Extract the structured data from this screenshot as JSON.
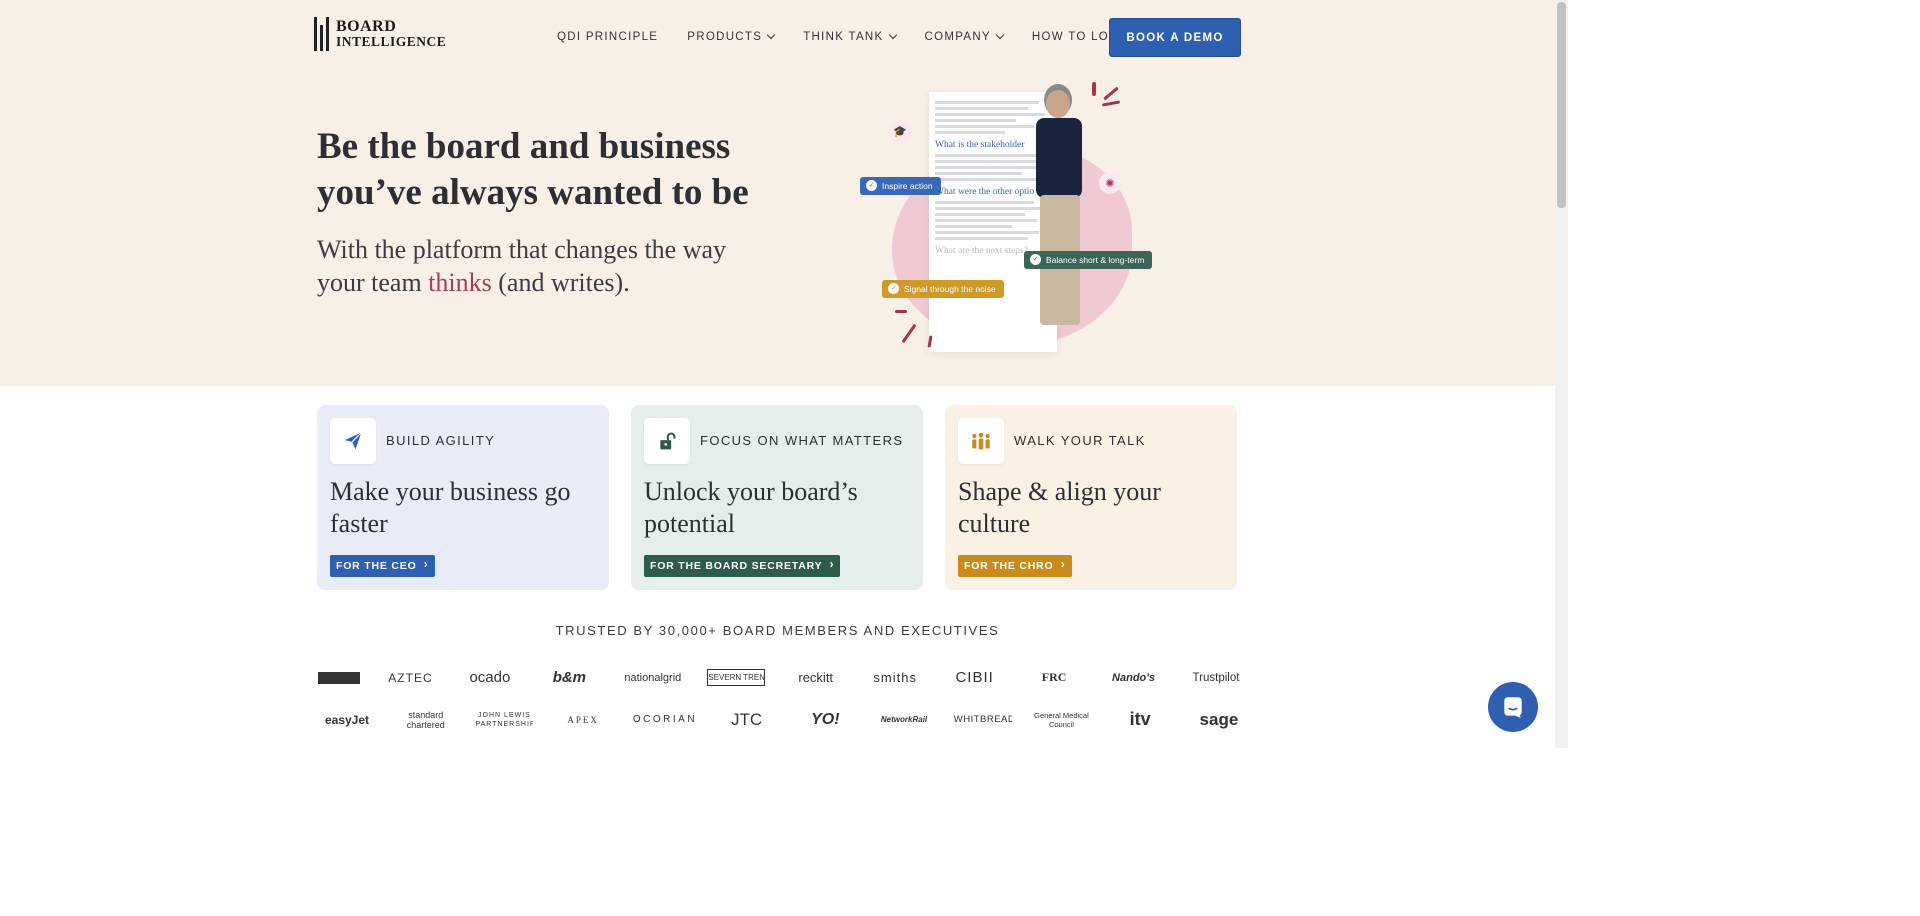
{
  "brand": {
    "line1": "BOARD",
    "line2": "INTELLIGENCE"
  },
  "nav": {
    "items": [
      {
        "label": "QDI PRINCIPLE",
        "dropdown": false
      },
      {
        "label": "PRODUCTS",
        "dropdown": true
      },
      {
        "label": "THINK TANK",
        "dropdown": true
      },
      {
        "label": "COMPANY",
        "dropdown": true
      },
      {
        "label": "HOW TO LOG IN",
        "dropdown": false
      }
    ],
    "cta": "BOOK A DEMO"
  },
  "hero": {
    "title": "Be the board and business you’ve always wanted to be",
    "sub_before": "With the platform that changes the way your team ",
    "sub_highlight": "thinks",
    "sub_after": " (and writes).",
    "illustration": {
      "chips": [
        "Inspire action",
        "Balance short & long-term",
        "Signal through the noise"
      ],
      "doc_headings": [
        "What is the stakeholder",
        "What were the other optio",
        "What are the next steps?"
      ]
    }
  },
  "cards": [
    {
      "tag": "BUILD AGILITY",
      "heading": "Make your business go faster",
      "button": "FOR THE CEO",
      "icon": "paper-plane-icon",
      "accent": "#2f5fb0"
    },
    {
      "tag": "FOCUS ON WHAT MATTERS",
      "heading": "Unlock your board’s potential",
      "button": "FOR THE BOARD SECRETARY",
      "icon": "unlock-icon",
      "accent": "#2f5b4b"
    },
    {
      "tag": "WALK YOUR TALK",
      "heading": "Shape & align your culture",
      "button": "FOR THE CHRO",
      "icon": "people-icon",
      "accent": "#c98c1c"
    }
  ],
  "trusted": {
    "heading": "TRUSTED BY 30,000+ BOARD MEMBERS AND EXECUTIVES",
    "row1": [
      "",
      "AZTEC",
      "ocado",
      "b&m",
      "nationalgrid",
      "SEVERN TRENT",
      "reckitt",
      "smiths",
      "CIBII",
      "FRC",
      "Nando's",
      "Trustpilot"
    ],
    "row2": [
      "easyJet",
      "standard chartered",
      "JOHN LEWIS PARTNERSHIP",
      "APEX",
      "OCORIAN",
      "JTC",
      "YO!",
      "NetworkRail",
      "WHITBREAD",
      "General Medical Council",
      "itv",
      "sage"
    ]
  },
  "colors": {
    "hero_bg": "#f8f0e7",
    "primary": "#2f5fb0",
    "highlight": "#a83b5a"
  }
}
